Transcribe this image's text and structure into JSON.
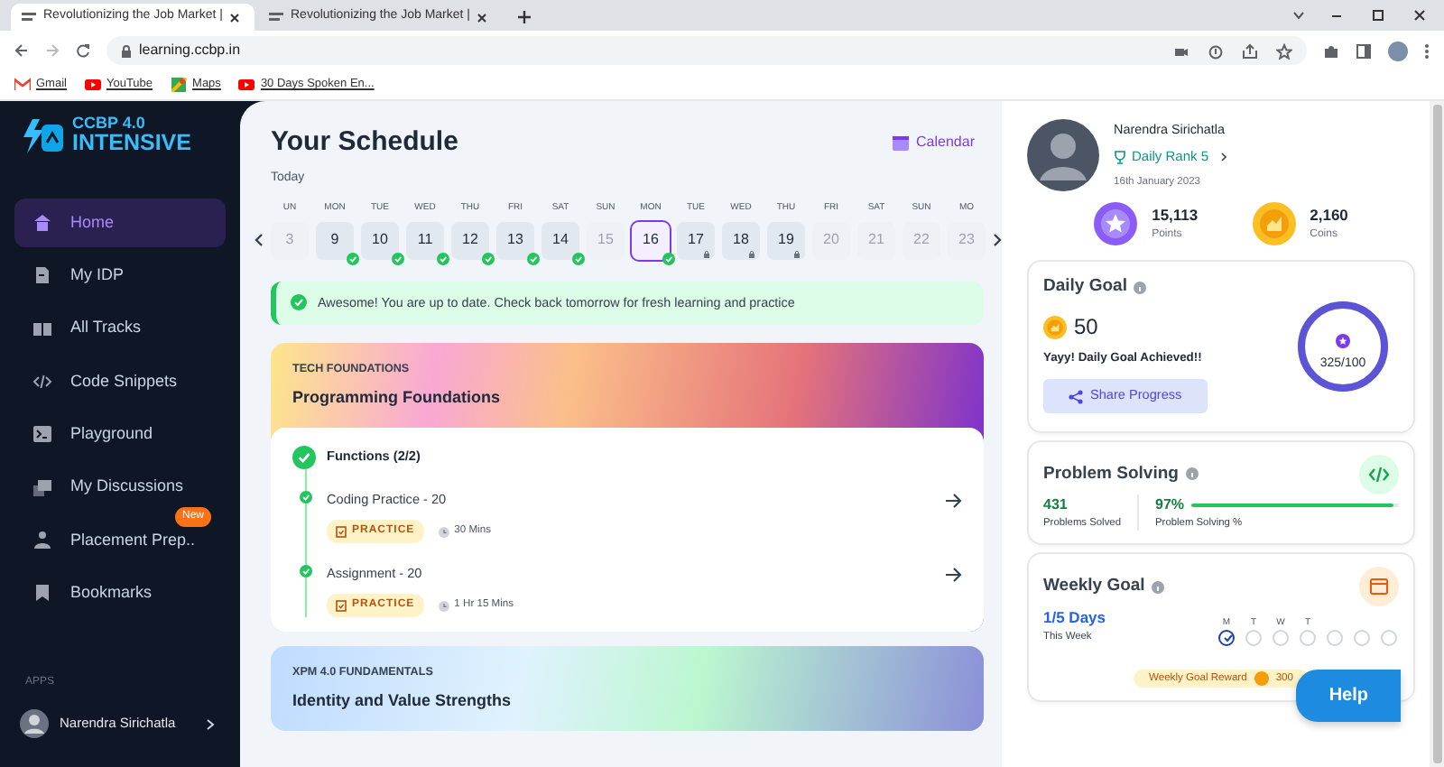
{
  "browser": {
    "tabs": [
      {
        "title": "Revolutionizing the Job Market |",
        "selected": true
      },
      {
        "title": "Revolutionizing the Job Market |",
        "selected": false
      }
    ],
    "address": "learning.ccbp.in",
    "bookmarks": [
      {
        "label": "Gmail",
        "kind": "mail"
      },
      {
        "label": "YouTube",
        "kind": "video"
      },
      {
        "label": "Maps",
        "kind": "map"
      },
      {
        "label": "30 Days Spoken En...",
        "kind": "video"
      }
    ]
  },
  "sidebar": {
    "logo": {
      "line1": "CCBP 4.0",
      "line2": "INTENSIVE"
    },
    "items": [
      {
        "label": "Home",
        "kind": "home",
        "selected": true
      },
      {
        "label": "My IDP",
        "kind": "document",
        "selected": false
      },
      {
        "label": "All Tracks",
        "kind": "book",
        "selected": false
      },
      {
        "label": "Code Snippets",
        "kind": "code",
        "selected": false
      },
      {
        "label": "Playground",
        "kind": "terminal",
        "selected": false
      },
      {
        "label": "My Discussions",
        "kind": "chat",
        "selected": false
      },
      {
        "label": "Placement Prep..",
        "kind": "person",
        "selected": false,
        "badge": "New"
      },
      {
        "label": "Bookmarks",
        "kind": "bookmark",
        "selected": false
      }
    ],
    "section_label": "APPS",
    "user": {
      "name": "Narendra Sirichatla"
    }
  },
  "schedule": {
    "title": "Your Schedule",
    "calendar_link": "Calendar",
    "subtitle": "Today",
    "days": [
      {
        "weekday": "UN",
        "date": "3",
        "kind": "muted",
        "selected": false
      },
      {
        "weekday": "MON",
        "date": "9",
        "kind": "done",
        "selected": false
      },
      {
        "weekday": "TUE",
        "date": "10",
        "kind": "done",
        "selected": false
      },
      {
        "weekday": "WED",
        "date": "11",
        "kind": "done",
        "selected": false
      },
      {
        "weekday": "THU",
        "date": "12",
        "kind": "done",
        "selected": false
      },
      {
        "weekday": "FRI",
        "date": "13",
        "kind": "done",
        "selected": false
      },
      {
        "weekday": "SAT",
        "date": "14",
        "kind": "done",
        "selected": false
      },
      {
        "weekday": "SUN",
        "date": "15",
        "kind": "muted",
        "selected": false
      },
      {
        "weekday": "MON",
        "date": "16",
        "kind": "done",
        "selected": true
      },
      {
        "weekday": "TUE",
        "date": "17",
        "kind": "pending",
        "selected": false
      },
      {
        "weekday": "WED",
        "date": "18",
        "kind": "pending",
        "selected": false
      },
      {
        "weekday": "THU",
        "date": "19",
        "kind": "pending",
        "selected": false
      },
      {
        "weekday": "FRI",
        "date": "20",
        "kind": "muted",
        "selected": false
      },
      {
        "weekday": "SAT",
        "date": "21",
        "kind": "muted",
        "selected": false
      },
      {
        "weekday": "SUN",
        "date": "22",
        "kind": "muted",
        "selected": false
      },
      {
        "weekday": "MO",
        "date": "23",
        "kind": "muted",
        "selected": false
      }
    ],
    "alert": "Awesome! You are up to date. Check back tomorrow for fresh learning and practice",
    "courses": [
      {
        "track": "TECH FOUNDATIONS",
        "title": "Programming Foundations",
        "kind": "warm",
        "topic": {
          "title": "Functions (2/2)",
          "completed": true,
          "items": [
            {
              "title": "Coding Practice - 20",
              "tag": "PRACTICE",
              "duration": "30 Mins",
              "completed": true
            },
            {
              "title": "Assignment - 20",
              "tag": "PRACTICE",
              "duration": "1 Hr 15 Mins",
              "completed": true
            }
          ]
        }
      },
      {
        "track": "XPM 4.0 FUNDAMENTALS",
        "title": "Identity and Value Strengths",
        "kind": "cool"
      }
    ]
  },
  "profile": {
    "name": "Narendra Sirichatla",
    "rank": "Daily Rank 5",
    "date": "16th January 2023",
    "stats": [
      {
        "value": "15,113",
        "label": "Points",
        "kind": "points"
      },
      {
        "value": "2,160",
        "label": "Coins",
        "kind": "coins"
      }
    ]
  },
  "daily_goal": {
    "title": "Daily Goal",
    "coins": "50",
    "message": "Yayy! Daily Goal Achieved!!",
    "button": "Share Progress",
    "progress": "325/100",
    "level": 1
  },
  "problem_solving": {
    "title": "Problem Solving",
    "solved": "431",
    "solved_label": "Problems Solved",
    "percent": "97%",
    "percent_label": "Problem Solving %",
    "level": 0.97
  },
  "weekly_goal": {
    "title": "Weekly Goal",
    "days_count": "1/5 Days",
    "caption": "This Week",
    "days": [
      {
        "label": "M",
        "checked": true
      },
      {
        "label": "T",
        "checked": false
      },
      {
        "label": "W",
        "checked": false
      },
      {
        "label": "T",
        "checked": false
      },
      {
        "checked": false
      },
      {
        "checked": false
      },
      {
        "checked": false
      }
    ],
    "reward_label": "Weekly Goal Reward",
    "reward": "300"
  },
  "help_button": "Help"
}
